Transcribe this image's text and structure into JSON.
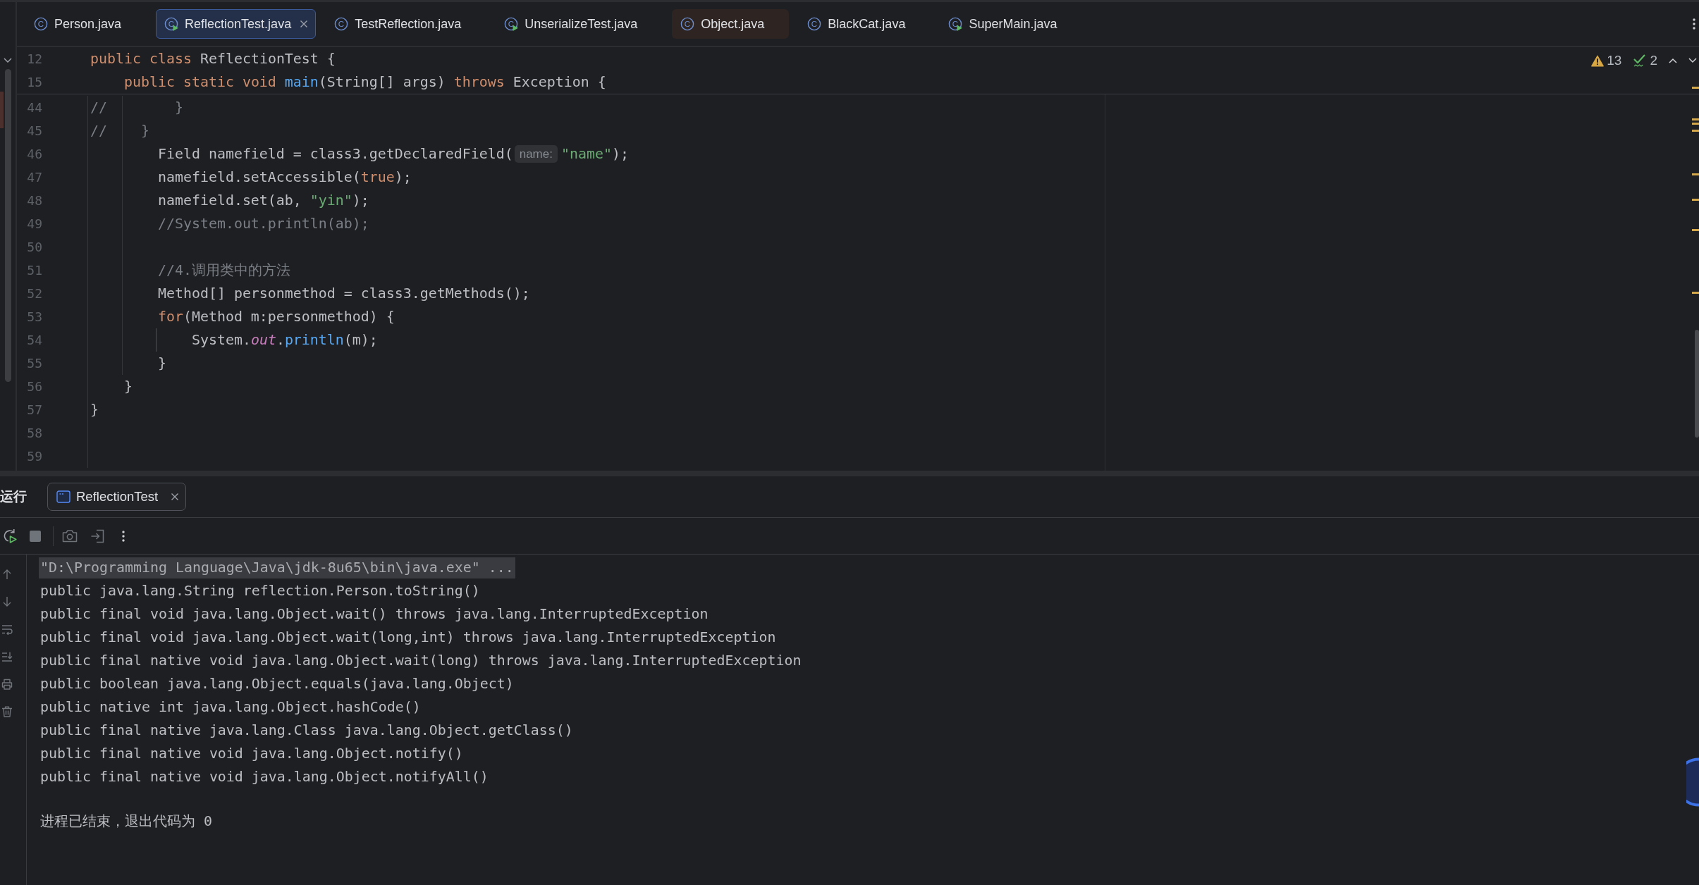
{
  "editor_tabs": [
    {
      "label": "Person.java",
      "kind": "class",
      "icon_letter": "C",
      "selected": false,
      "tinted": false
    },
    {
      "label": "ReflectionTest.java",
      "kind": "runnable_class",
      "icon_letter": "C",
      "selected": true,
      "tinted": false
    },
    {
      "label": "TestReflection.java",
      "kind": "class",
      "icon_letter": "C",
      "selected": false,
      "tinted": false
    },
    {
      "label": "UnserializeTest.java",
      "kind": "runnable_class",
      "icon_letter": "C",
      "selected": false,
      "tinted": false
    },
    {
      "label": "Object.java",
      "kind": "class",
      "icon_letter": "C",
      "selected": false,
      "tinted": true
    },
    {
      "label": "BlackCat.java",
      "kind": "class",
      "icon_letter": "C",
      "selected": false,
      "tinted": false
    },
    {
      "label": "SuperMain.java",
      "kind": "runnable_class",
      "icon_letter": "C",
      "selected": false,
      "tinted": false
    }
  ],
  "editor": {
    "sticky_lines": [
      {
        "number": "12",
        "tokens": [
          {
            "text": "public class",
            "kind": "keyword"
          },
          {
            "text": " ReflectionTest {",
            "kind": "plain"
          }
        ]
      },
      {
        "number": "15",
        "tokens": [
          {
            "text": "    public static void ",
            "kind": "keyword"
          },
          {
            "text": "main",
            "kind": "method"
          },
          {
            "text": "(String[] args) ",
            "kind": "plain"
          },
          {
            "text": "throws",
            "kind": "keyword"
          },
          {
            "text": " Exception {",
            "kind": "plain"
          }
        ]
      }
    ],
    "lines": [
      {
        "number": "44",
        "tokens": [
          {
            "text": "//        }",
            "kind": "comment"
          }
        ]
      },
      {
        "number": "45",
        "tokens": [
          {
            "text": "//    }",
            "kind": "comment"
          }
        ]
      },
      {
        "number": "46",
        "tokens": [
          {
            "text": "        Field namefield = class3.getDeclaredField(",
            "kind": "plain"
          },
          {
            "text": "name:",
            "kind": "hint"
          },
          {
            "text": "\"name\"",
            "kind": "string"
          },
          {
            "text": ");",
            "kind": "plain"
          }
        ]
      },
      {
        "number": "47",
        "tokens": [
          {
            "text": "        namefield.setAccessible(",
            "kind": "plain"
          },
          {
            "text": "true",
            "kind": "keyword"
          },
          {
            "text": ");",
            "kind": "plain"
          }
        ]
      },
      {
        "number": "48",
        "tokens": [
          {
            "text": "        namefield.set(ab, ",
            "kind": "plain"
          },
          {
            "text": "\"yin\"",
            "kind": "string"
          },
          {
            "text": ");",
            "kind": "plain"
          }
        ]
      },
      {
        "number": "49",
        "tokens": [
          {
            "text": "        //System.out.println(ab);",
            "kind": "comment"
          }
        ]
      },
      {
        "number": "50"
      },
      {
        "number": "51",
        "tokens": [
          {
            "text": "        //4.调用类中的方法",
            "kind": "comment"
          }
        ]
      },
      {
        "number": "52",
        "tokens": [
          {
            "text": "        Method[] personmethod = class3.getMethods();",
            "kind": "plain"
          }
        ]
      },
      {
        "number": "53",
        "tokens": [
          {
            "text": "        for",
            "kind": "keyword"
          },
          {
            "text": "(Method m:personmethod) {",
            "kind": "plain"
          }
        ]
      },
      {
        "number": "54",
        "tokens": [
          {
            "text": "            System.",
            "kind": "plain"
          },
          {
            "text": "out",
            "kind": "static_field"
          },
          {
            "text": ".",
            "kind": "plain"
          },
          {
            "text": "println",
            "kind": "method"
          },
          {
            "text": "(m);",
            "kind": "plain"
          }
        ]
      },
      {
        "number": "55",
        "tokens": [
          {
            "text": "        }",
            "kind": "plain"
          }
        ]
      },
      {
        "number": "56",
        "tokens": [
          {
            "text": "    }",
            "kind": "plain"
          }
        ]
      },
      {
        "number": "57",
        "tokens": [
          {
            "text": "}",
            "kind": "plain"
          }
        ]
      },
      {
        "number": "58"
      },
      {
        "number": "59"
      }
    ],
    "inspections": [
      {
        "kind": "warning",
        "count": "13"
      },
      {
        "kind": "typo",
        "count": "2"
      }
    ]
  },
  "run_panel": {
    "title": "运行",
    "tabs": [
      {
        "label": "ReflectionTest",
        "selected": true
      }
    ],
    "console": {
      "lines": [
        {
          "kind": "command",
          "text": "\"D:\\Programming Language\\Java\\jdk-8u65\\bin\\java.exe\" ..."
        },
        {
          "kind": "output",
          "text": "public java.lang.String reflection.Person.toString()"
        },
        {
          "kind": "output",
          "text": "public final void java.lang.Object.wait() throws java.lang.InterruptedException"
        },
        {
          "kind": "output",
          "text": "public final void java.lang.Object.wait(long,int) throws java.lang.InterruptedException"
        },
        {
          "kind": "output",
          "text": "public final native void java.lang.Object.wait(long) throws java.lang.InterruptedException"
        },
        {
          "kind": "output",
          "text": "public boolean java.lang.Object.equals(java.lang.Object)"
        },
        {
          "kind": "output",
          "text": "public native int java.lang.Object.hashCode()"
        },
        {
          "kind": "output",
          "text": "public final native java.lang.Class java.lang.Object.getClass()"
        },
        {
          "kind": "output",
          "text": "public final native void java.lang.Object.notify()"
        },
        {
          "kind": "output",
          "text": "public final native void java.lang.Object.notifyAll()"
        }
      ],
      "exit_message": "进程已结束，退出代码为 0"
    }
  }
}
